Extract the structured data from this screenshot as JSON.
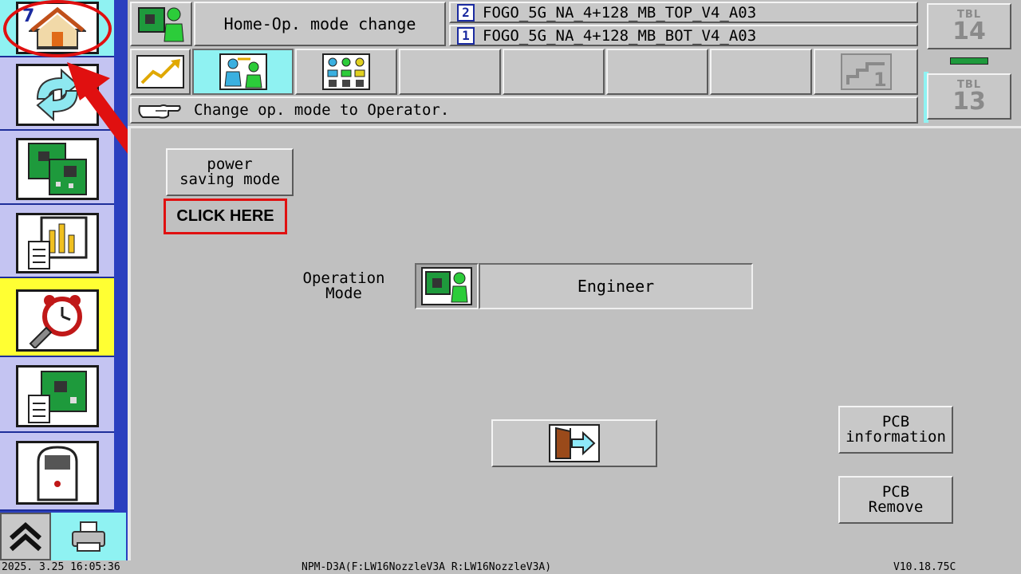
{
  "header": {
    "title": "Home-Op. mode change",
    "files": [
      {
        "num": "2",
        "name": "FOGO_5G_NA_4+128_MB_TOP_V4_A03"
      },
      {
        "num": "1",
        "name": "FOGO_5G_NA_4+128_MB_BOT_V4_A03"
      }
    ],
    "tables": [
      {
        "label": "TBL",
        "number": "14"
      },
      {
        "label": "TBL",
        "number": "13"
      }
    ]
  },
  "sidebar": {
    "home_badge": "7"
  },
  "message": "Change op. mode to Operator.",
  "main": {
    "power_saving_label": "power\nsaving mode",
    "power_saving_line1": "power",
    "power_saving_line2": "saving mode",
    "click_here": "CLICK HERE",
    "opmode_line1": "Operation",
    "opmode_line2": "Mode",
    "opmode_value": "Engineer",
    "pcb_info_line1": "PCB",
    "pcb_info_line2": "information",
    "pcb_remove_line1": "PCB",
    "pcb_remove_line2": "Remove"
  },
  "status": {
    "datetime": "2025.  3.25 16:05:36",
    "machine": "NPM-D3A(F:LW16NozzleV3A   R:LW16NozzleV3A)",
    "version": "V10.18.75C"
  },
  "colors": {
    "annotation": "#e01010",
    "sidebar_blue": "#2a3fbf",
    "sidebar_cell": "#c4c4f2",
    "highlight_yellow": "#ffff33",
    "active_cyan": "#8ff2f2"
  }
}
